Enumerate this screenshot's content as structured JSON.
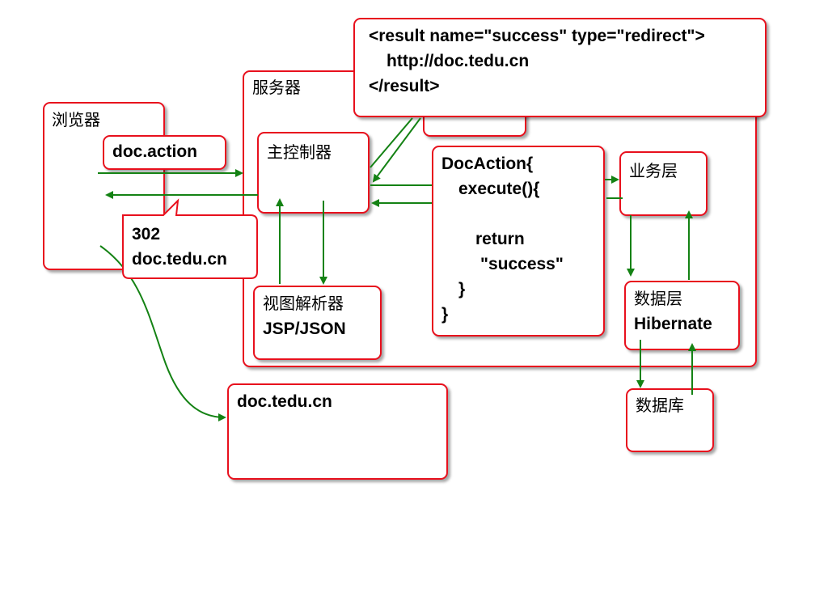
{
  "diagram": {
    "browser": "浏览器",
    "request_url": "doc.action",
    "redirect_callout": {
      "status": "302",
      "location": "doc.tedu.cn"
    },
    "server": "服务器",
    "main_controller": "主控制器",
    "config": {
      "line1": "<result name=\"success\" type=\"redirect\">",
      "line2": "http://doc.tedu.cn",
      "line3": "</result>"
    },
    "action": {
      "line1": "DocAction{",
      "line2": "execute(){",
      "line3": "return",
      "line4": "\"success\"",
      "line5": "}",
      "line6": "}"
    },
    "view_resolver": {
      "title": "视图解析器",
      "subtitle": "JSP/JSON"
    },
    "business_layer": "业务层",
    "data_layer": {
      "title": "数据层",
      "subtitle": "Hibernate"
    },
    "database": "数据库",
    "target_page": "doc.tedu.cn"
  },
  "colors": {
    "border": "#e8101d",
    "arrow": "#148214",
    "text": "#000000"
  }
}
